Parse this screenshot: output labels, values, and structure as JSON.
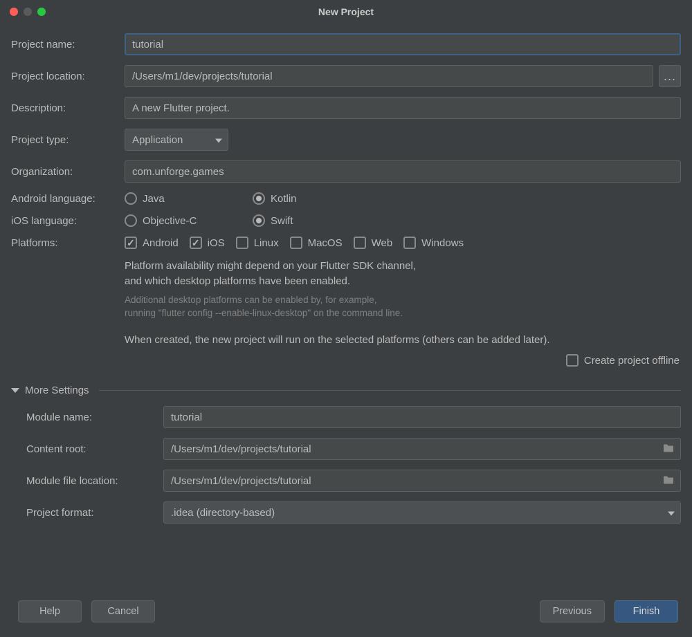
{
  "window": {
    "title": "New Project"
  },
  "labels": {
    "project_name": "Project name:",
    "project_location": "Project location:",
    "description": "Description:",
    "project_type": "Project type:",
    "organization": "Organization:",
    "android_language": "Android language:",
    "ios_language": "iOS language:",
    "platforms": "Platforms:",
    "module_name": "Module name:",
    "content_root": "Content root:",
    "module_file_location": "Module file location:",
    "project_format": "Project format:"
  },
  "values": {
    "project_name": "tutorial",
    "project_location": "/Users/m1/dev/projects/tutorial",
    "description": "A new Flutter project.",
    "project_type": "Application",
    "organization": "com.unforge.games",
    "module_name": "tutorial",
    "content_root": "/Users/m1/dev/projects/tutorial",
    "module_file_location": "/Users/m1/dev/projects/tutorial",
    "project_format": ".idea (directory-based)"
  },
  "android_language": {
    "options": [
      {
        "label": "Java",
        "checked": false
      },
      {
        "label": "Kotlin",
        "checked": true
      }
    ]
  },
  "ios_language": {
    "options": [
      {
        "label": "Objective-C",
        "checked": false
      },
      {
        "label": "Swift",
        "checked": true
      }
    ]
  },
  "platforms": {
    "options": [
      {
        "label": "Android",
        "checked": true
      },
      {
        "label": "iOS",
        "checked": true
      },
      {
        "label": "Linux",
        "checked": false
      },
      {
        "label": "MacOS",
        "checked": false
      },
      {
        "label": "Web",
        "checked": false
      },
      {
        "label": "Windows",
        "checked": false
      }
    ]
  },
  "notes": {
    "platform_sdk_1": "Platform availability might depend on your Flutter SDK channel,",
    "platform_sdk_2": "and which desktop platforms have been enabled.",
    "additional_1": "Additional desktop platforms can be enabled by, for example,",
    "additional_2": "running \"flutter config --enable-linux-desktop\" on the command line.",
    "when_created": "When created, the new project will run on the selected platforms (others can be added later)."
  },
  "offline": {
    "label": "Create project offline",
    "checked": false
  },
  "more_settings": {
    "title": "More Settings"
  },
  "buttons": {
    "help": "Help",
    "cancel": "Cancel",
    "previous": "Previous",
    "finish": "Finish",
    "browse": "..."
  }
}
